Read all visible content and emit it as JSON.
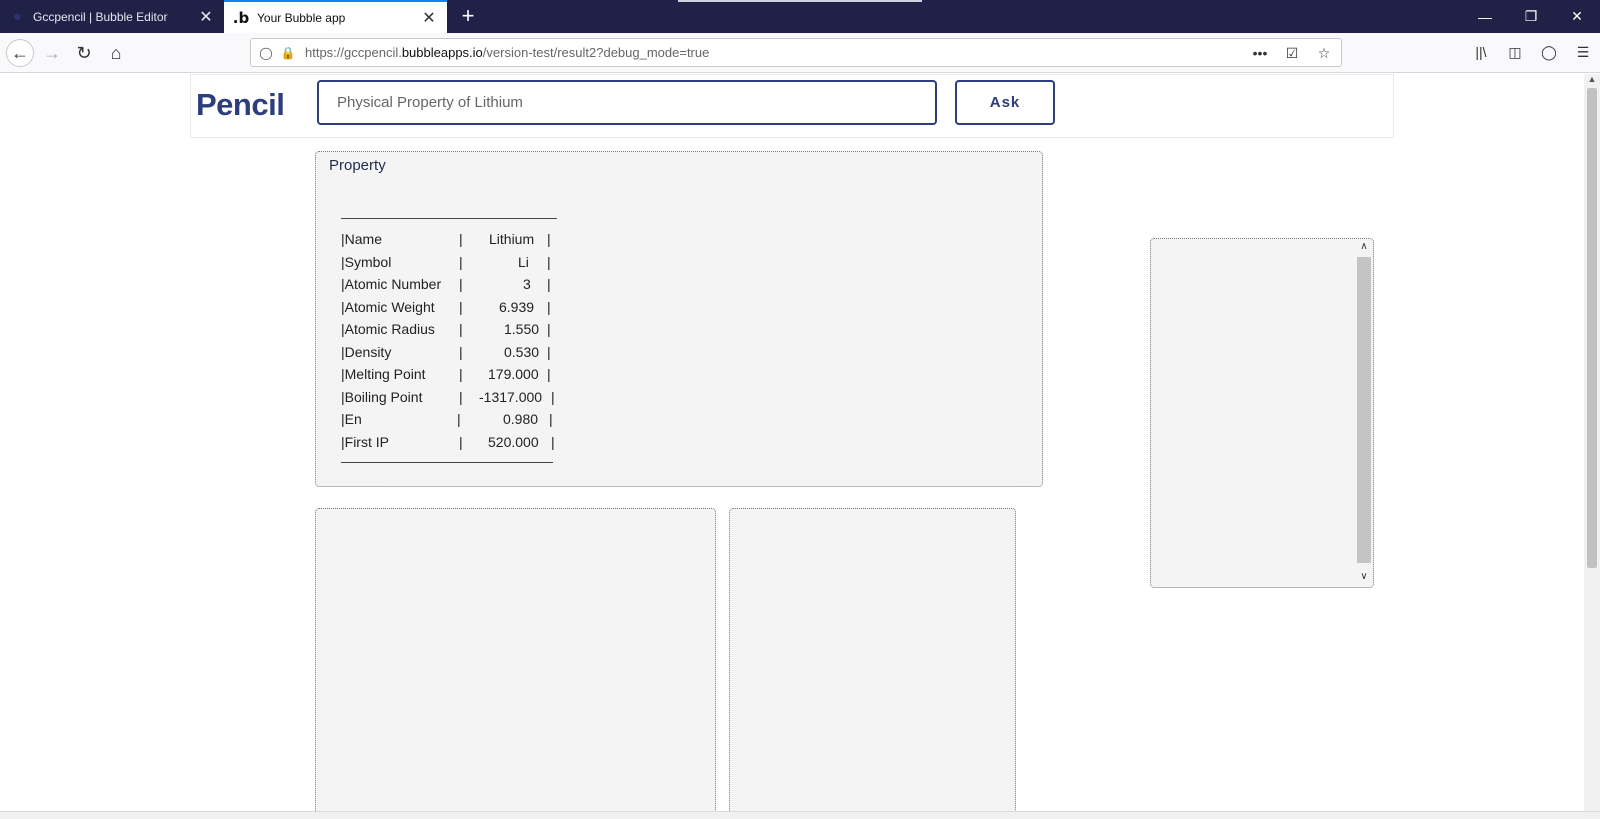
{
  "browser": {
    "tabs": [
      {
        "title": "Gccpencil | Bubble Editor",
        "icon": "bubble-editor-icon"
      },
      {
        "title": "Your Bubble app",
        "icon": "bubble-b-icon"
      }
    ],
    "url_prefix": "https://gccpencil.",
    "url_host": "bubbleapps.io",
    "url_path": "/version-test/result2?debug_mode=true"
  },
  "app": {
    "logo": "Pencil",
    "search_value": "Physical Property of Lithium",
    "ask_label": "Ask"
  },
  "property": {
    "title": "Property",
    "rows": [
      {
        "name": "|Name",
        "value": "Lithium",
        "end": "|"
      },
      {
        "name": "|Symbol",
        "value": "Li",
        "end": "|"
      },
      {
        "name": "|Atomic Number",
        "value": "3",
        "end": "|"
      },
      {
        "name": "|Atomic Weight",
        "value": "6.939",
        "end": "|"
      },
      {
        "name": "|Atomic Radius",
        "value": "1.550",
        "end": "|"
      },
      {
        "name": "|Density",
        "value": "0.530",
        "end": "|"
      },
      {
        "name": "|Melting Point",
        "value": "179.000",
        "end": "|"
      },
      {
        "name": "|Boiling Point",
        "value": "-1317.000",
        "end": "|"
      },
      {
        "name": "|En",
        "value": "0.980",
        "end": "|"
      },
      {
        "name": "|First IP",
        "value": "520.000",
        "end": "|"
      }
    ]
  }
}
